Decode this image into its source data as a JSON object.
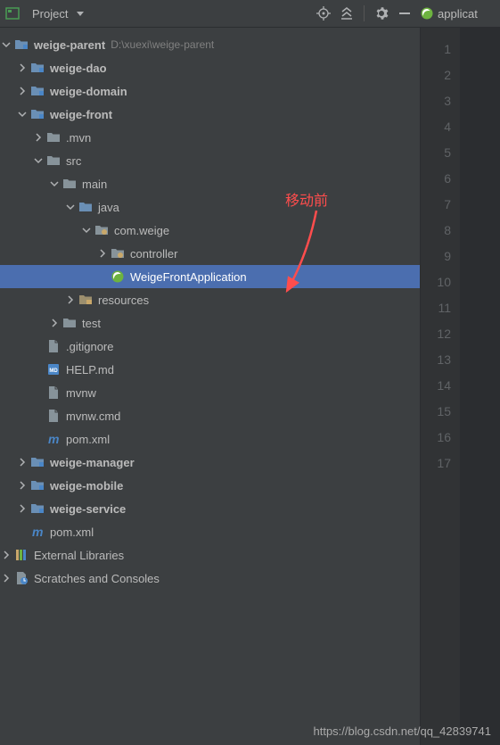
{
  "toolbar": {
    "title": "Project"
  },
  "editor": {
    "tabLabel": "applicat",
    "lineCount": 17
  },
  "annotation": {
    "text": "移动前"
  },
  "watermark": "https://blog.csdn.net/qq_42839741",
  "tree": [
    {
      "depth": 0,
      "arrow": "open",
      "icon": "module",
      "label": "weige-parent",
      "bold": true,
      "path": "D:\\xuexi\\weige-parent"
    },
    {
      "depth": 1,
      "arrow": "closed",
      "icon": "module",
      "label": "weige-dao",
      "bold": true
    },
    {
      "depth": 1,
      "arrow": "closed",
      "icon": "module",
      "label": "weige-domain",
      "bold": true
    },
    {
      "depth": 1,
      "arrow": "open",
      "icon": "module",
      "label": "weige-front",
      "bold": true
    },
    {
      "depth": 2,
      "arrow": "closed",
      "icon": "folder",
      "label": ".mvn"
    },
    {
      "depth": 2,
      "arrow": "open",
      "icon": "folder",
      "label": "src"
    },
    {
      "depth": 3,
      "arrow": "open",
      "icon": "folder",
      "label": "main"
    },
    {
      "depth": 4,
      "arrow": "open",
      "icon": "src-folder",
      "label": "java"
    },
    {
      "depth": 5,
      "arrow": "open",
      "icon": "package",
      "label": "com.weige"
    },
    {
      "depth": 6,
      "arrow": "closed",
      "icon": "package",
      "label": "controller"
    },
    {
      "depth": 6,
      "arrow": "none",
      "icon": "spring-class",
      "label": "WeigeFrontApplication",
      "selected": true
    },
    {
      "depth": 4,
      "arrow": "closed",
      "icon": "res-folder",
      "label": "resources"
    },
    {
      "depth": 3,
      "arrow": "closed",
      "icon": "folder",
      "label": "test"
    },
    {
      "depth": 2,
      "arrow": "none",
      "icon": "file",
      "label": ".gitignore"
    },
    {
      "depth": 2,
      "arrow": "none",
      "icon": "md-file",
      "label": "HELP.md"
    },
    {
      "depth": 2,
      "arrow": "none",
      "icon": "file",
      "label": "mvnw"
    },
    {
      "depth": 2,
      "arrow": "none",
      "icon": "file",
      "label": "mvnw.cmd"
    },
    {
      "depth": 2,
      "arrow": "none",
      "icon": "maven",
      "label": "pom.xml"
    },
    {
      "depth": 1,
      "arrow": "closed",
      "icon": "module",
      "label": "weige-manager",
      "bold": true
    },
    {
      "depth": 1,
      "arrow": "closed",
      "icon": "module",
      "label": "weige-mobile",
      "bold": true
    },
    {
      "depth": 1,
      "arrow": "closed",
      "icon": "module",
      "label": "weige-service",
      "bold": true
    },
    {
      "depth": 1,
      "arrow": "none",
      "icon": "maven",
      "label": "pom.xml"
    },
    {
      "depth": 0,
      "arrow": "closed",
      "icon": "libs",
      "label": "External Libraries"
    },
    {
      "depth": 0,
      "arrow": "closed",
      "icon": "scratch",
      "label": "Scratches and Consoles"
    }
  ]
}
